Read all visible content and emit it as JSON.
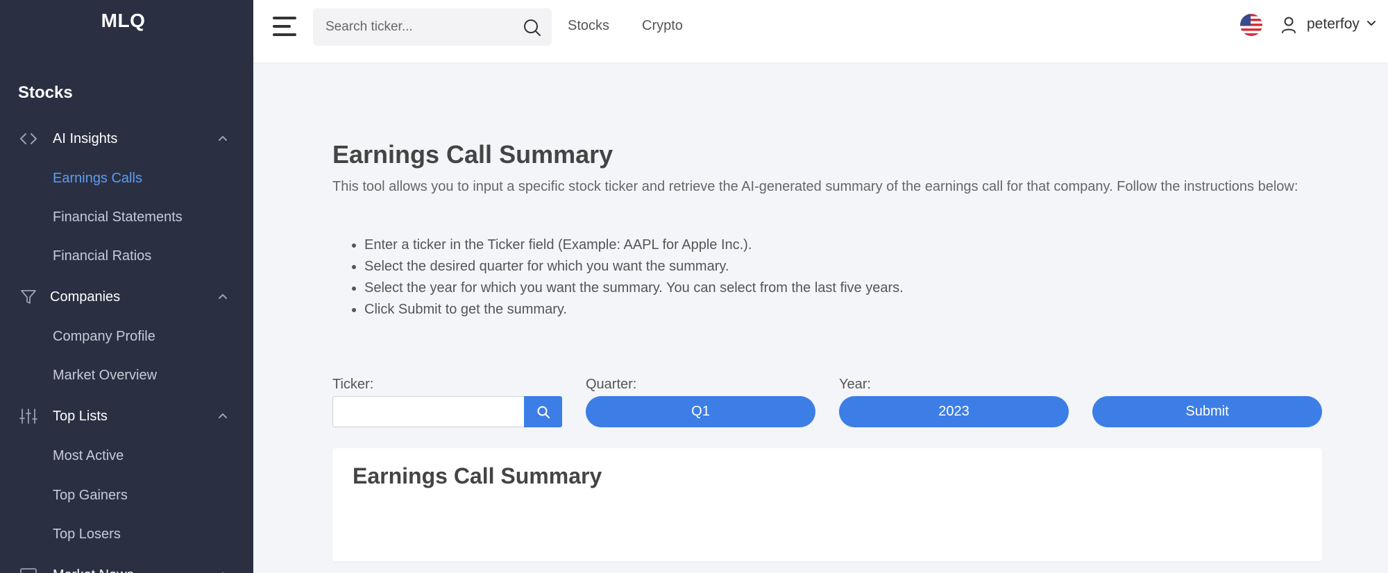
{
  "sidebar": {
    "logo": "MLQ",
    "heading": "Stocks",
    "groups": [
      {
        "label": "AI Insights",
        "icon": "code-icon",
        "items": [
          "Earnings Calls",
          "Financial Statements",
          "Financial Ratios"
        ]
      },
      {
        "label": "Companies",
        "icon": "filter-icon",
        "items": [
          "Company Profile",
          "Market Overview"
        ]
      },
      {
        "label": "Top Lists",
        "icon": "sliders-icon",
        "items": [
          "Most Active",
          "Top Gainers",
          "Top Losers"
        ]
      },
      {
        "label": "Market News",
        "icon": "monitor-icon",
        "items": []
      }
    ],
    "active_item": "Earnings Calls"
  },
  "topbar": {
    "search_placeholder": "Search ticker...",
    "links": [
      "Stocks",
      "Crypto"
    ],
    "flag": "us-flag-icon",
    "username": "peterfoy"
  },
  "main": {
    "title": "Earnings Call Summary",
    "intro": "This tool allows you to input a specific stock ticker and retrieve the AI-generated summary of the earnings call for that company. Follow the instructions below:",
    "steps": [
      "Enter a ticker in the Ticker field (Example: AAPL for Apple Inc.).",
      "Select the desired quarter for which you want the summary.",
      "Select the year for which you want the summary. You can select from the last five years.",
      "Click Submit to get the summary."
    ],
    "form": {
      "ticker_label": "Ticker:",
      "ticker_value": "",
      "quarter_label": "Quarter:",
      "quarter_value": "Q1",
      "year_label": "Year:",
      "year_value": "2023",
      "submit_label": "Submit"
    },
    "result_title": "Earnings Call Summary"
  },
  "colors": {
    "sidebar_bg": "#2a3042",
    "accent": "#3d7ee6",
    "active_link": "#5f9cf1",
    "page_bg": "#f4f5f8"
  }
}
